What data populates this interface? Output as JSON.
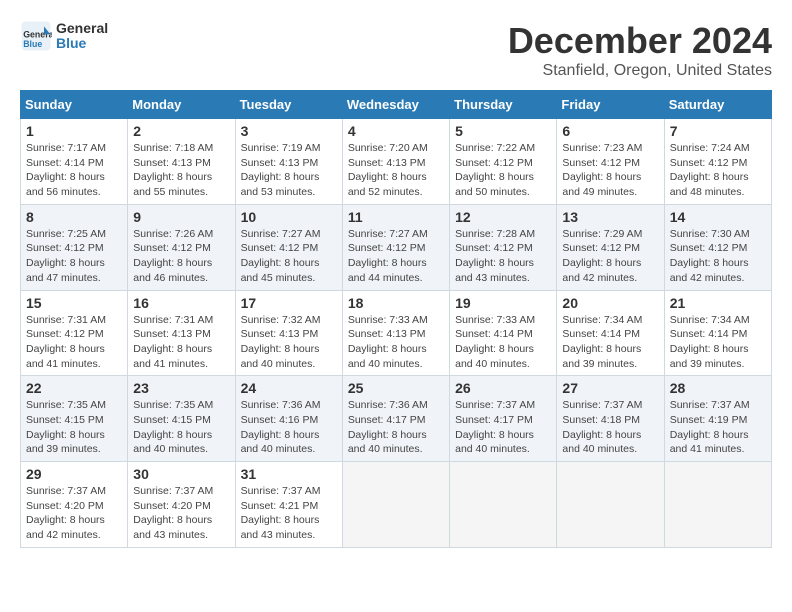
{
  "logo": {
    "line1": "General",
    "line2": "Blue"
  },
  "title": "December 2024",
  "subtitle": "Stanfield, Oregon, United States",
  "days_of_week": [
    "Sunday",
    "Monday",
    "Tuesday",
    "Wednesday",
    "Thursday",
    "Friday",
    "Saturday"
  ],
  "weeks": [
    [
      {
        "day": "1",
        "sunrise": "7:17 AM",
        "sunset": "4:14 PM",
        "daylight": "8 hours and 56 minutes."
      },
      {
        "day": "2",
        "sunrise": "7:18 AM",
        "sunset": "4:13 PM",
        "daylight": "8 hours and 55 minutes."
      },
      {
        "day": "3",
        "sunrise": "7:19 AM",
        "sunset": "4:13 PM",
        "daylight": "8 hours and 53 minutes."
      },
      {
        "day": "4",
        "sunrise": "7:20 AM",
        "sunset": "4:13 PM",
        "daylight": "8 hours and 52 minutes."
      },
      {
        "day": "5",
        "sunrise": "7:22 AM",
        "sunset": "4:12 PM",
        "daylight": "8 hours and 50 minutes."
      },
      {
        "day": "6",
        "sunrise": "7:23 AM",
        "sunset": "4:12 PM",
        "daylight": "8 hours and 49 minutes."
      },
      {
        "day": "7",
        "sunrise": "7:24 AM",
        "sunset": "4:12 PM",
        "daylight": "8 hours and 48 minutes."
      }
    ],
    [
      {
        "day": "8",
        "sunrise": "7:25 AM",
        "sunset": "4:12 PM",
        "daylight": "8 hours and 47 minutes."
      },
      {
        "day": "9",
        "sunrise": "7:26 AM",
        "sunset": "4:12 PM",
        "daylight": "8 hours and 46 minutes."
      },
      {
        "day": "10",
        "sunrise": "7:27 AM",
        "sunset": "4:12 PM",
        "daylight": "8 hours and 45 minutes."
      },
      {
        "day": "11",
        "sunrise": "7:27 AM",
        "sunset": "4:12 PM",
        "daylight": "8 hours and 44 minutes."
      },
      {
        "day": "12",
        "sunrise": "7:28 AM",
        "sunset": "4:12 PM",
        "daylight": "8 hours and 43 minutes."
      },
      {
        "day": "13",
        "sunrise": "7:29 AM",
        "sunset": "4:12 PM",
        "daylight": "8 hours and 42 minutes."
      },
      {
        "day": "14",
        "sunrise": "7:30 AM",
        "sunset": "4:12 PM",
        "daylight": "8 hours and 42 minutes."
      }
    ],
    [
      {
        "day": "15",
        "sunrise": "7:31 AM",
        "sunset": "4:12 PM",
        "daylight": "8 hours and 41 minutes."
      },
      {
        "day": "16",
        "sunrise": "7:31 AM",
        "sunset": "4:13 PM",
        "daylight": "8 hours and 41 minutes."
      },
      {
        "day": "17",
        "sunrise": "7:32 AM",
        "sunset": "4:13 PM",
        "daylight": "8 hours and 40 minutes."
      },
      {
        "day": "18",
        "sunrise": "7:33 AM",
        "sunset": "4:13 PM",
        "daylight": "8 hours and 40 minutes."
      },
      {
        "day": "19",
        "sunrise": "7:33 AM",
        "sunset": "4:14 PM",
        "daylight": "8 hours and 40 minutes."
      },
      {
        "day": "20",
        "sunrise": "7:34 AM",
        "sunset": "4:14 PM",
        "daylight": "8 hours and 39 minutes."
      },
      {
        "day": "21",
        "sunrise": "7:34 AM",
        "sunset": "4:14 PM",
        "daylight": "8 hours and 39 minutes."
      }
    ],
    [
      {
        "day": "22",
        "sunrise": "7:35 AM",
        "sunset": "4:15 PM",
        "daylight": "8 hours and 39 minutes."
      },
      {
        "day": "23",
        "sunrise": "7:35 AM",
        "sunset": "4:15 PM",
        "daylight": "8 hours and 40 minutes."
      },
      {
        "day": "24",
        "sunrise": "7:36 AM",
        "sunset": "4:16 PM",
        "daylight": "8 hours and 40 minutes."
      },
      {
        "day": "25",
        "sunrise": "7:36 AM",
        "sunset": "4:17 PM",
        "daylight": "8 hours and 40 minutes."
      },
      {
        "day": "26",
        "sunrise": "7:37 AM",
        "sunset": "4:17 PM",
        "daylight": "8 hours and 40 minutes."
      },
      {
        "day": "27",
        "sunrise": "7:37 AM",
        "sunset": "4:18 PM",
        "daylight": "8 hours and 40 minutes."
      },
      {
        "day": "28",
        "sunrise": "7:37 AM",
        "sunset": "4:19 PM",
        "daylight": "8 hours and 41 minutes."
      }
    ],
    [
      {
        "day": "29",
        "sunrise": "7:37 AM",
        "sunset": "4:20 PM",
        "daylight": "8 hours and 42 minutes."
      },
      {
        "day": "30",
        "sunrise": "7:37 AM",
        "sunset": "4:20 PM",
        "daylight": "8 hours and 43 minutes."
      },
      {
        "day": "31",
        "sunrise": "7:37 AM",
        "sunset": "4:21 PM",
        "daylight": "8 hours and 43 minutes."
      },
      null,
      null,
      null,
      null
    ]
  ]
}
